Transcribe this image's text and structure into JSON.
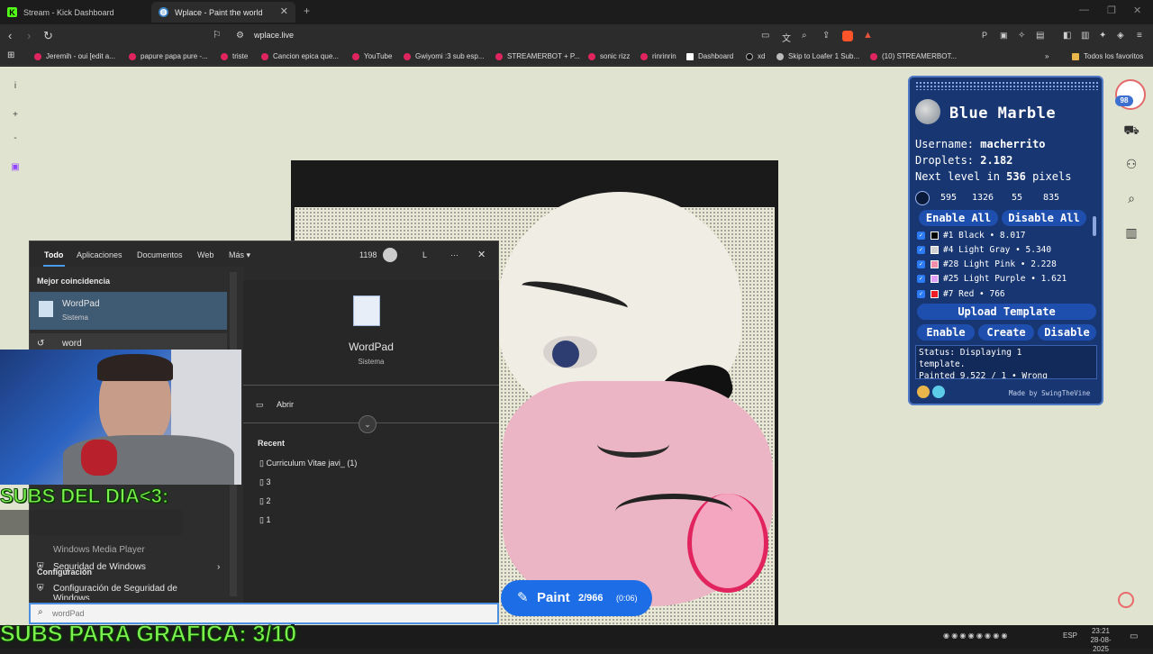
{
  "tabs": [
    {
      "title": "Stream - Kick Dashboard",
      "icon": "kick-icon"
    },
    {
      "title": "Wplace - Paint the world",
      "icon": "globe-icon"
    }
  ],
  "address": {
    "url": "wplace.live"
  },
  "bookmarks": [
    "Jeremih - oui [edit a...",
    "papure papa pure -...",
    "triste",
    "Cancion epica que...",
    "YouTube",
    "Gwiyomi :3 sub esp...",
    "STREAMERBOT + P...",
    "sonic rizz",
    "rinrinrin",
    "Dashboard",
    "xd",
    "Skip to Loafer 1 Sub...",
    "(10) STREAMERBOT..."
  ],
  "bookmarks_all": "Todos los favoritos",
  "page_sidebar": [
    "i",
    "+",
    "-"
  ],
  "blue_marble": {
    "title": "Blue Marble",
    "username_label": "Username:",
    "username": "macherrito",
    "droplets_label": "Droplets:",
    "droplets": "2.182",
    "next_level_pre": "Next level in",
    "next_level_value": "536",
    "next_level_post": "pixels",
    "coords": [
      "595",
      "1326",
      "55",
      "835"
    ],
    "enable_all": "Enable All",
    "disable_all": "Disable All",
    "colors": [
      {
        "label": "#1 Black • 8.017",
        "hex": "#000000"
      },
      {
        "label": "#4 Light Gray • 5.340",
        "hex": "#d2d2d2"
      },
      {
        "label": "#28 Light Pink • 2.228",
        "hex": "#f38da9"
      },
      {
        "label": "#25 Light Purple • 1.621",
        "hex": "#e09ff9"
      },
      {
        "label": "#7 Red • 766",
        "hex": "#ed1c24"
      }
    ],
    "upload_template": "Upload Template",
    "enable": "Enable",
    "create": "Create",
    "disable": "Disable",
    "status_line1": "Status: Displaying 1",
    "status_line2": "template.",
    "status_line3": "Painted 9.522 / 1 • Wrong",
    "made_by": "Made by SwingTheVine"
  },
  "badge_count": "98",
  "search": {
    "tabs": [
      "Todo",
      "Aplicaciones",
      "Documentos",
      "Web",
      "Más"
    ],
    "points": "1198",
    "avatar": "L",
    "best_match_label": "Mejor coincidencia",
    "best_match_name": "WordPad",
    "best_match_type": "Sistema",
    "suggestion": "word",
    "left_item_wmp": "Windows Media Player",
    "config_label": "Configuración",
    "config_items": [
      "Seguridad de Windows",
      "Configuración de Seguridad de Windows"
    ],
    "detail_name": "WordPad",
    "detail_type": "Sistema",
    "open_label": "Abrir",
    "recent_label": "Recent",
    "recent_items": [
      "Curriculum Vitae javi_ (1)",
      "3",
      "2",
      "1"
    ],
    "query": "wordPad"
  },
  "overlay": {
    "subs_day": "SUBS DEL DIA<3:",
    "subs_graph": "SUBS PARA GRAFICA: 3/10"
  },
  "paint_button": {
    "label": "Paint",
    "count": "2/966",
    "timer": "(0:06)"
  },
  "taskbar": {
    "lang": "ESP",
    "time": "23:21",
    "date": "28-08-2025"
  }
}
